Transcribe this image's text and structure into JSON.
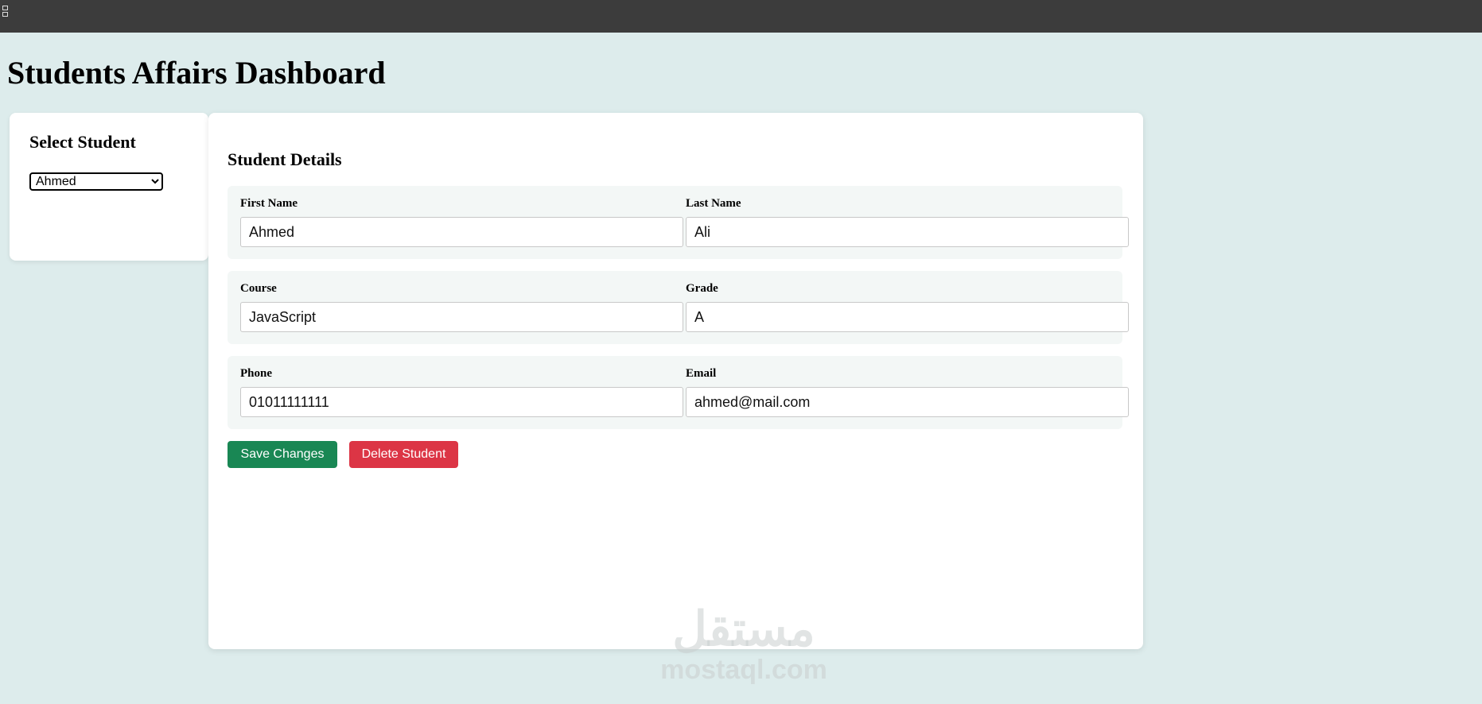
{
  "page": {
    "title": "Students Affairs Dashboard"
  },
  "sidebar": {
    "heading": "Select Student",
    "selected_student": "Ahmed"
  },
  "details": {
    "heading": "Student Details",
    "fields": [
      {
        "label": "First Name",
        "value": "Ahmed"
      },
      {
        "label": "Last Name",
        "value": "Ali"
      },
      {
        "label": "Course",
        "value": "JavaScript"
      },
      {
        "label": "Grade",
        "value": "A"
      },
      {
        "label": "Phone",
        "value": "01011111111"
      },
      {
        "label": "Email",
        "value": "ahmed@mail.com"
      }
    ],
    "save_label": "Save Changes",
    "delete_label": "Delete Student"
  },
  "colors": {
    "save": "#198754",
    "delete": "#dc3545",
    "background": "#ddecec"
  },
  "watermark": {
    "arabic": "مستقل",
    "text": "mostaql.com"
  }
}
